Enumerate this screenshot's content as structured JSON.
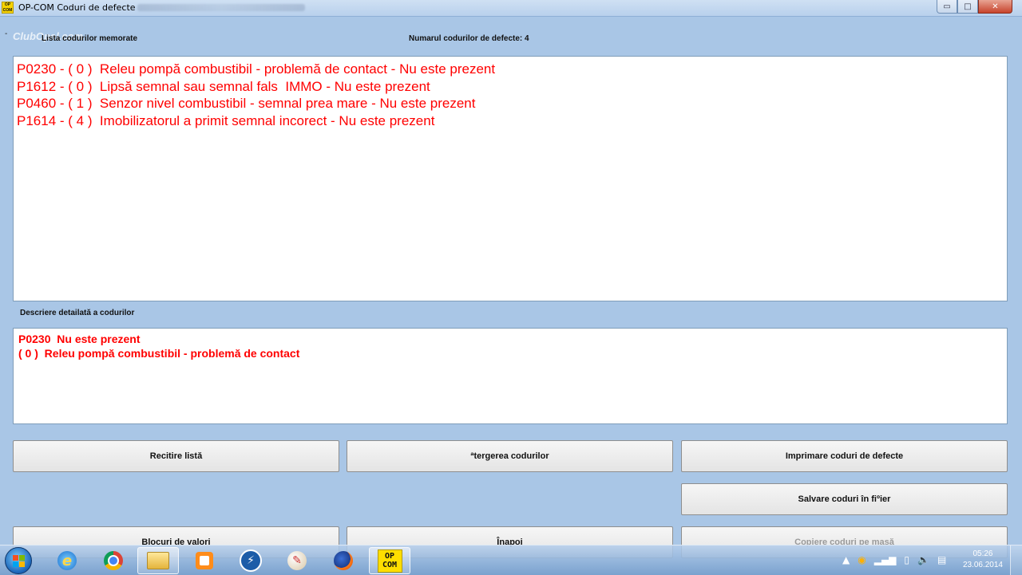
{
  "window": {
    "app_icon_text": "OP COM",
    "title": "OP-COM   Coduri de defecte",
    "minimize_glyph": "▭",
    "maximize_glyph": "□",
    "close_glyph": "✕"
  },
  "watermark": "ClubOpel.com",
  "header": {
    "list_label": "Lista codurilor memorate",
    "count_label": "Numarul codurilor de defecte: 4"
  },
  "codes": [
    "P0230 - ( 0 )  Releu pompă combustibil - problemă de contact - Nu este prezent",
    "P1612 - ( 0 )  Lipsă semnal sau semnal fals  IMMO - Nu este prezent",
    "P0460 - ( 1 )  Senzor nivel combustibil - semnal prea mare - Nu este prezent",
    "P1614 - ( 4 )  Imobilizatorul a primit semnal incorect - Nu este prezent"
  ],
  "detail": {
    "label": "Descriere detailată a codurilor",
    "line1": "P0230  Nu este prezent",
    "line2": "( 0 )  Releu pompă combustibil - problemă de contact"
  },
  "buttons": {
    "reread": "Recitire listă",
    "erase": "ªtergerea codurilor",
    "print": "Imprimare coduri de defecte",
    "save": "Salvare coduri în fiºier",
    "value_blocks": "Blocuri de valori",
    "back": "Înapoi",
    "copy": "Copiere coduri pe masă"
  },
  "taskbar": {
    "opcom_label": "OP COM",
    "clock_time": "05:26",
    "clock_date": "23.06.2014"
  },
  "colors": {
    "fault_text": "#ff0000",
    "background": "#a9c6e6"
  }
}
